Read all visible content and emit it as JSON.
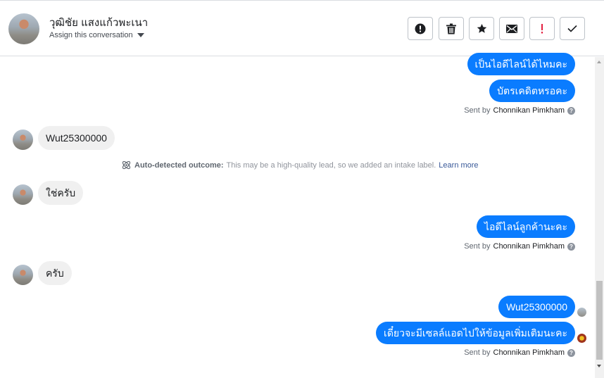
{
  "header": {
    "contact_name": "วุฒิชัย แสงแก้วพะเนา",
    "assign_label": "Assign this conversation",
    "toolbar": [
      {
        "name": "spam-button",
        "icon": "alert-circle-icon"
      },
      {
        "name": "delete-button",
        "icon": "trash-icon"
      },
      {
        "name": "star-button",
        "icon": "star-icon"
      },
      {
        "name": "mark-unread-button",
        "icon": "envelope-icon"
      },
      {
        "name": "follow-up-button",
        "icon": "exclamation-icon",
        "color": "#e41e3f"
      },
      {
        "name": "mark-done-button",
        "icon": "checkmark-icon"
      }
    ]
  },
  "messages": {
    "out1": "เป็นไอดีไลน์ได้ไหมคะ",
    "out2": "บัตรเคดิตหรอคะ",
    "sent_prefix": "Sent by",
    "sender": "Chonnikan Pimkham",
    "in1": "Wut25300000",
    "outcome_label": "Auto-detected outcome:",
    "outcome_text": "This may be a high-quality lead, so we added an intake label.",
    "outcome_link": "Learn more",
    "in2": "ใช่ครับ",
    "out3": "ไอดีไลน์ลูกค้านะคะ",
    "in3": "ครับ",
    "out4": "Wut25300000",
    "out5": "เดี๋ยวจะมีเซลล์แอดไปให้ข้อมูลเพิ่มเติมนะคะ"
  },
  "colors": {
    "accent": "#0a7cff",
    "incoming_bubble": "#f0f0f0",
    "link": "#385898"
  }
}
